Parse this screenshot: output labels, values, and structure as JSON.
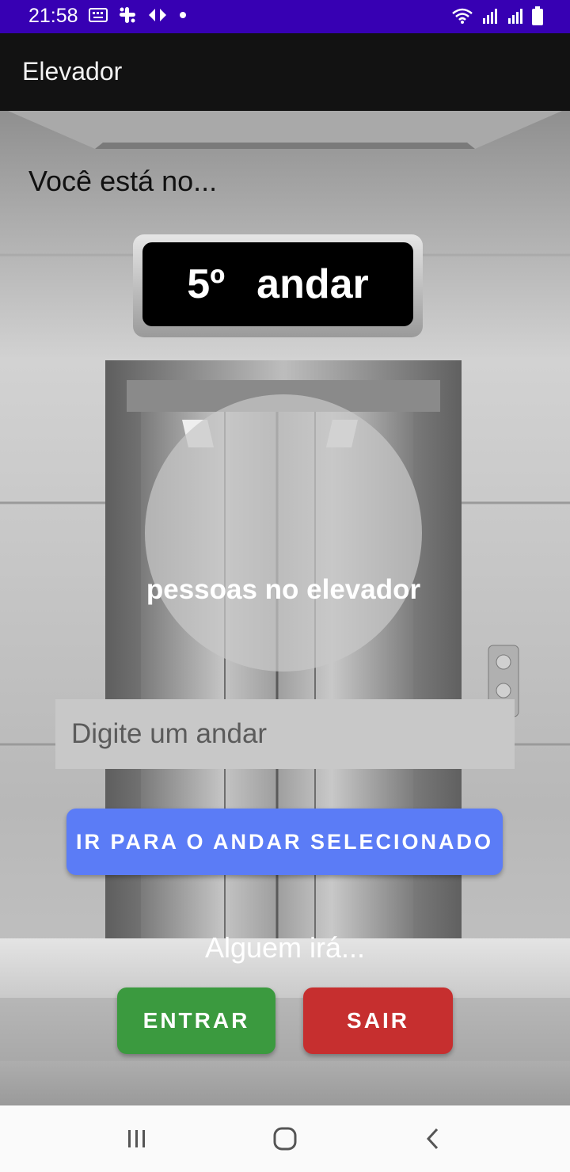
{
  "status_bar": {
    "time": "21:58",
    "icons": [
      "keyboard-icon",
      "slack-icon",
      "carrefour-icon",
      "dot-icon",
      "wifi-icon",
      "signal-icon",
      "signal-icon",
      "battery-icon"
    ]
  },
  "app_bar": {
    "title": "Elevador"
  },
  "main": {
    "intro": "Você está no...",
    "floor_number": "5º",
    "floor_word": "andar",
    "people_label": "pessoas no elevador",
    "floor_input_placeholder": "Digite um andar",
    "go_button": "IR PARA O ANDAR SELECIONADO",
    "someone_will": "Alguem irá...",
    "enter_button": "ENTRAR",
    "exit_button": "SAIR"
  },
  "colors": {
    "status_bar": "#3700b3",
    "app_bar": "#121212",
    "go_button": "#5b7cf6",
    "enter_button": "#3b9a3f",
    "exit_button": "#c62f2f"
  },
  "nav_bar": {
    "icons": [
      "recent-apps-icon",
      "home-icon",
      "back-icon"
    ]
  }
}
